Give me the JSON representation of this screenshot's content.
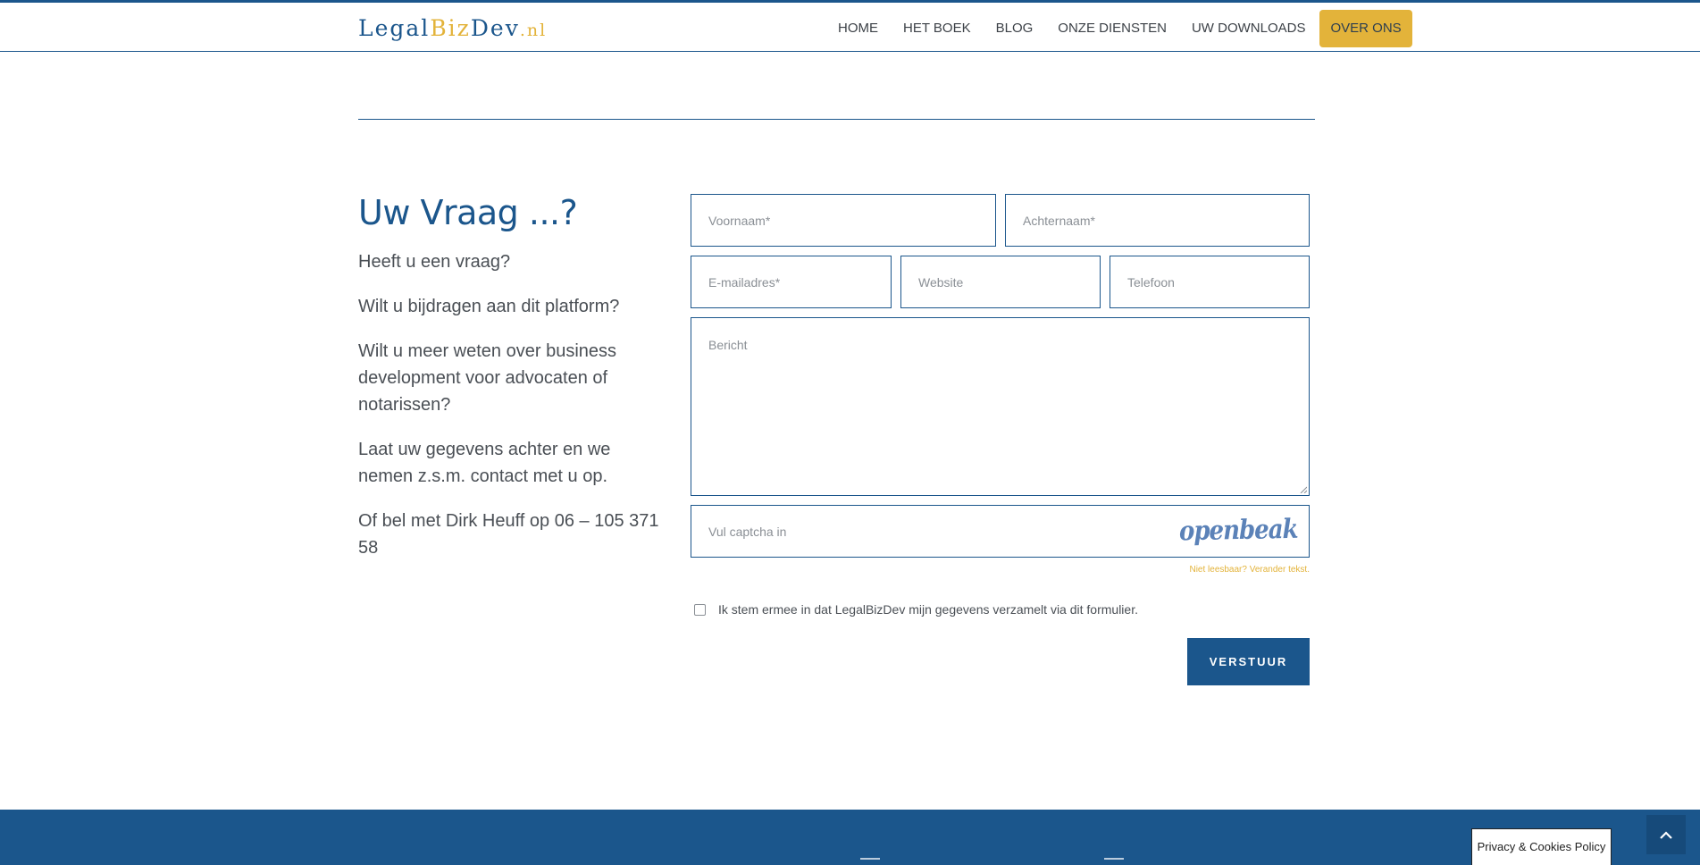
{
  "header": {
    "logo": {
      "part1": "Legal",
      "part2": "Biz",
      "part3": "Dev",
      "part4": ".nl"
    },
    "nav": [
      {
        "label": "HOME"
      },
      {
        "label": "HET BOEK"
      },
      {
        "label": "BLOG"
      },
      {
        "label": "ONZE DIENSTEN"
      },
      {
        "label": "UW DOWNLOADS"
      },
      {
        "label": "OVER ONS"
      }
    ]
  },
  "intro": {
    "heading": "Uw Vraag ...?",
    "paragraphs": [
      "Heeft u een vraag?",
      "Wilt u bijdragen aan dit platform?",
      "Wilt u meer weten over business development voor advocaten of notarissen?",
      "Laat uw gegevens achter en we nemen z.s.m. contact met u op.",
      "Of bel met Dirk Heuff op 06 – 105 371 58"
    ]
  },
  "form": {
    "voornaam_placeholder": "Voornaam*",
    "achternaam_placeholder": "Achternaam*",
    "email_placeholder": "E-mailadres*",
    "website_placeholder": "Website",
    "telefoon_placeholder": "Telefoon",
    "bericht_placeholder": "Bericht",
    "captcha_placeholder": "Vul captcha in",
    "captcha_word": "openbeak",
    "refresh_label": "Niet leesbaar? Verander tekst.",
    "consent_label": "Ik stem ermee in dat LegalBizDev mijn gegevens verzamelt via dit formulier.",
    "submit_label": "VERSTUUR"
  },
  "footer": {
    "privacy_label": "Privacy & Cookies Policy"
  },
  "colors": {
    "brand_blue": "#1b568c",
    "brand_gold": "#e3b33a"
  },
  "icons": {
    "scroll_top": "chevron-up-icon"
  }
}
